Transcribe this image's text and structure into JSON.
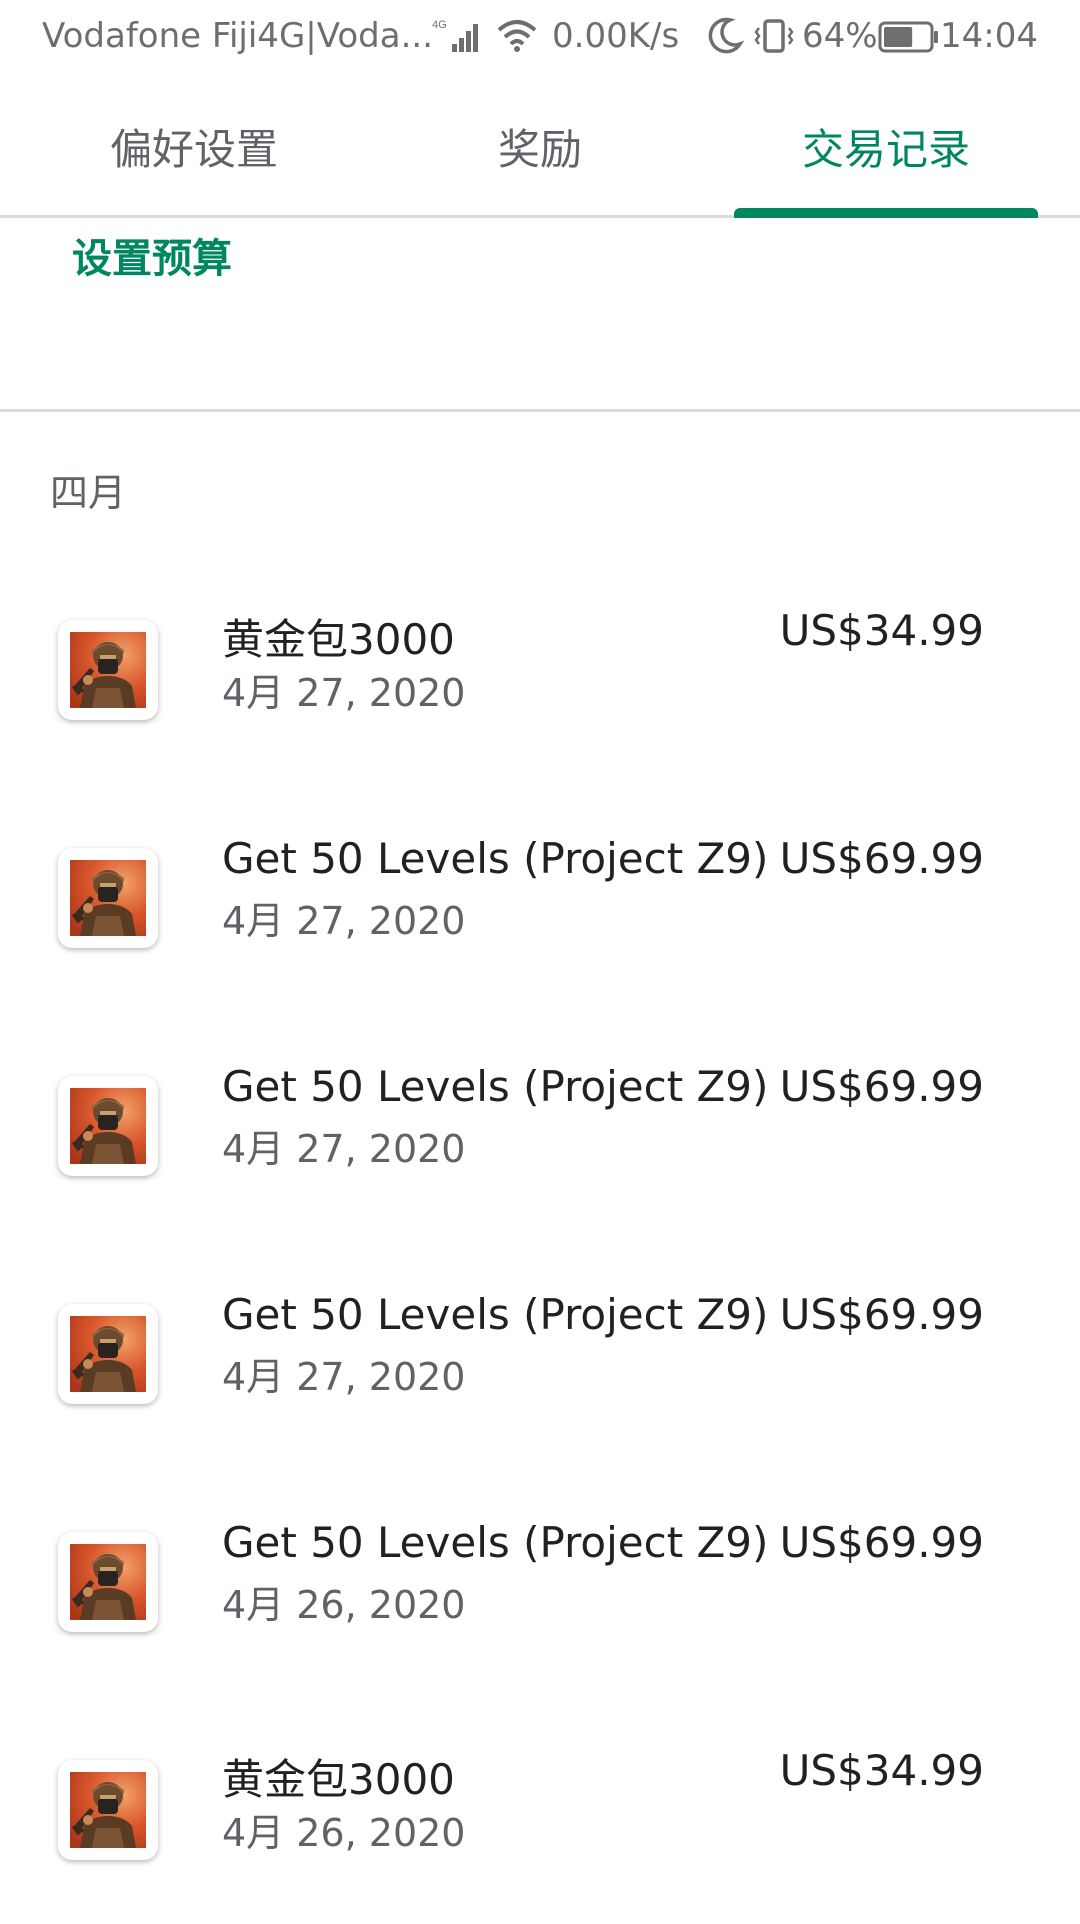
{
  "status_bar": {
    "carrier": "Vodafone Fiji4G|Voda...",
    "network_badge": "4G",
    "speed": "0.00K/s",
    "battery_percent": "64%",
    "battery_level": 0.64,
    "time": "14:04"
  },
  "tabs": [
    {
      "label": "偏好设置",
      "selected": false
    },
    {
      "label": "奖励",
      "selected": false
    },
    {
      "label": "交易记录",
      "selected": true
    }
  ],
  "budget": {
    "label": "设置预算"
  },
  "month_header": "四月",
  "transactions": [
    {
      "title": "黄金包3000",
      "date": "4月 27, 2020",
      "price": "US$34.99"
    },
    {
      "title": "Get 50 Levels (Project Z9)",
      "date": "4月 27, 2020",
      "price": "US$69.99"
    },
    {
      "title": "Get 50 Levels (Project Z9)",
      "date": "4月 27, 2020",
      "price": "US$69.99"
    },
    {
      "title": "Get 50 Levels (Project Z9)",
      "date": "4月 27, 2020",
      "price": "US$69.99"
    },
    {
      "title": "Get 50 Levels (Project Z9)",
      "date": "4月 26, 2020",
      "price": "US$69.99"
    },
    {
      "title": "黄金包3000",
      "date": "4月 26, 2020",
      "price": "US$34.99"
    }
  ],
  "colors": {
    "accent": "#01875f",
    "text_primary": "#212121",
    "text_secondary": "#5f6368",
    "divider": "#dcdcdc"
  },
  "icons": {
    "app_icon": "soldier-game-icon"
  }
}
